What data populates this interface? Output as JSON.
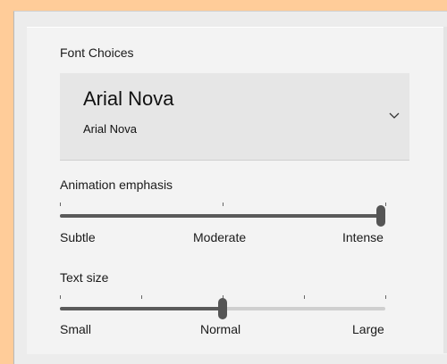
{
  "font_choices": {
    "label": "Font Choices",
    "selected_title": "Arial Nova",
    "selected_subtitle": "Arial Nova",
    "icon": "chevron-down-icon"
  },
  "animation_emphasis": {
    "label": "Animation emphasis",
    "value_fraction": 1.0,
    "ticks": [
      0,
      0.5,
      1
    ],
    "stops": [
      "Subtle",
      "Moderate",
      "Intense"
    ]
  },
  "text_size": {
    "label": "Text size",
    "value_fraction": 0.5,
    "ticks": [
      0,
      0.25,
      0.5,
      0.75,
      1
    ],
    "stops": [
      "Small",
      "Normal",
      "Large"
    ]
  },
  "colors": {
    "page_border": "#ffcc99",
    "panel_bg": "#f3f3f3",
    "track": "#cfcfcf",
    "fill": "#5a5a5a"
  }
}
